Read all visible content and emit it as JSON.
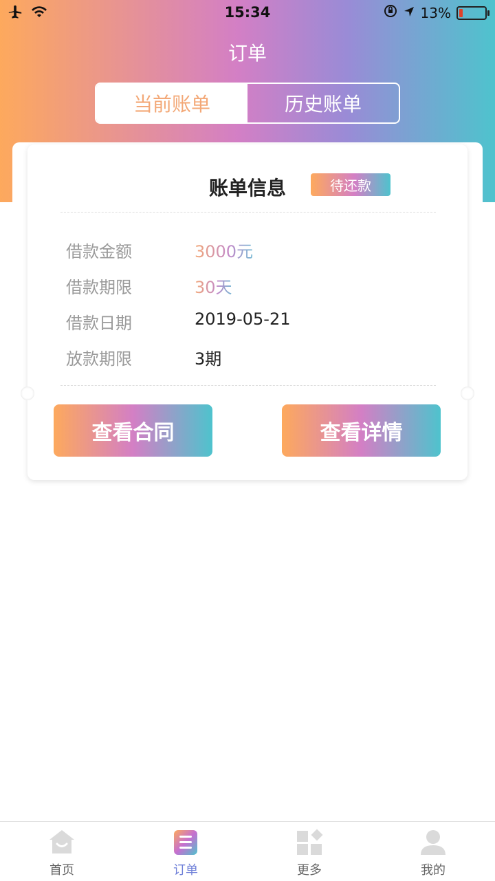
{
  "status_bar": {
    "time": "15:34",
    "battery": "13%"
  },
  "nav": {
    "title": "订单"
  },
  "tabs": [
    {
      "label": "当前账单"
    },
    {
      "label": "历史账单"
    }
  ],
  "card": {
    "title": "账单信息",
    "badge": "待还款",
    "rows": [
      {
        "label": "借款金额",
        "value": "3000元"
      },
      {
        "label": "借款期限",
        "value": "30天"
      },
      {
        "label": "借款日期",
        "value": "2019-05-21"
      },
      {
        "label": "放款期限",
        "value": "3期"
      }
    ],
    "buttons": {
      "contract": "查看合同",
      "details": "查看详情"
    }
  },
  "tabbar": [
    {
      "label": "首页",
      "icon": "home-icon"
    },
    {
      "label": "订单",
      "icon": "order-icon",
      "active": true
    },
    {
      "label": "更多",
      "icon": "grid-icon"
    },
    {
      "label": "我的",
      "icon": "profile-icon"
    }
  ],
  "colors": {
    "accent_orange": "#FDA95D",
    "accent_purple": "#D37FC5",
    "accent_teal": "#4EC3CD",
    "tab_active": "#6E7FD8"
  }
}
